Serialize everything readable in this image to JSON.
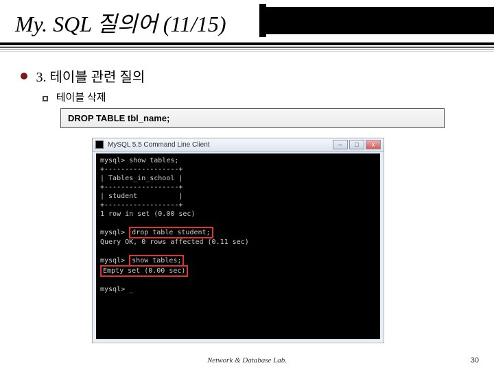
{
  "title": "My. SQL 질의어 (11/15)",
  "section": "3. 테이블 관련 질의",
  "subpoint": "테이블 삭제",
  "sql": "DROP TABLE tbl_name;",
  "term_title": "MySQL 5.5 Command Line Client",
  "term": {
    "l1": "mysql> show tables;",
    "l2": "+------------------+",
    "l3": "| Tables_in_school |",
    "l4": "+------------------+",
    "l5": "| student          |",
    "l6": "+------------------+",
    "l7": "1 row in set (0.00 sec)",
    "l8": "",
    "l9a": "mysql> ",
    "l9b": "drop table student;",
    "l10": "Query OK, 0 rows affected (0.11 sec)",
    "l11": "",
    "l12a": "mysql> ",
    "l12b": "show tables;",
    "l13": "Empty set (0.00 sec)",
    "l14": "",
    "l15": "mysql> _"
  },
  "footer": "Network & Database Lab.",
  "page": "30"
}
